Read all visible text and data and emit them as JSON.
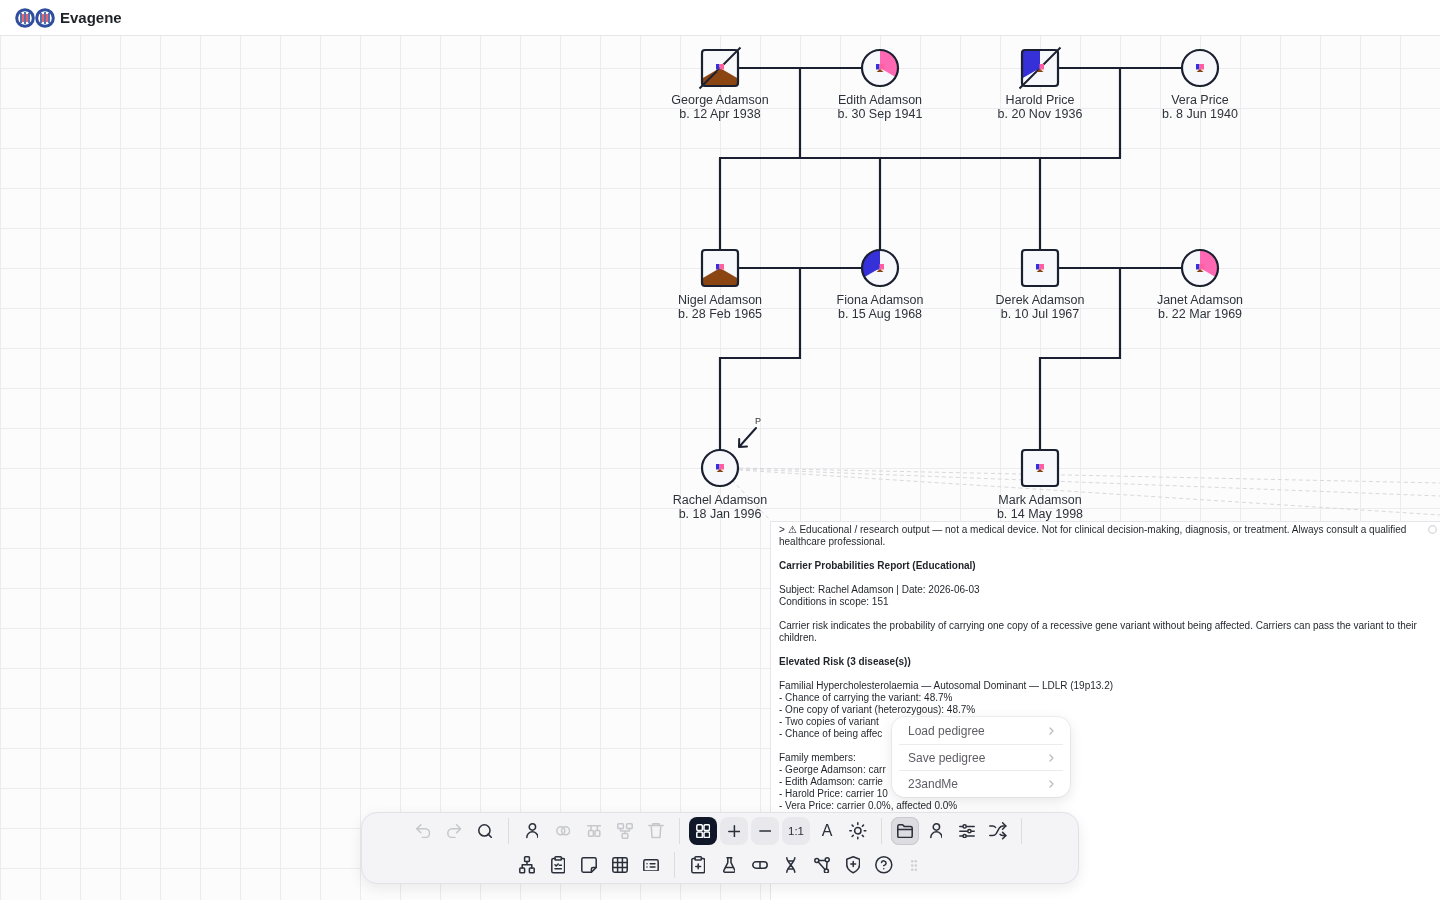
{
  "app": {
    "name": "Evagene"
  },
  "pedigree": {
    "proband_label": "P",
    "conditions": [
      {
        "color": "#ff69b4"
      },
      {
        "color": "#8b4513"
      },
      {
        "color": "#3530d8"
      }
    ],
    "generations": [
      {
        "individuals": [
          {
            "kind": "male",
            "name": "George Adamson",
            "birth": "b. 12 Apr 1938",
            "deceased": true,
            "proband": false,
            "affected": [
              false,
              true,
              false
            ]
          },
          {
            "kind": "female",
            "name": "Edith Adamson",
            "birth": "b. 30 Sep 1941",
            "deceased": false,
            "proband": false,
            "affected": [
              true,
              false,
              false
            ]
          },
          {
            "kind": "male",
            "name": "Harold Price",
            "birth": "b. 20 Nov 1936",
            "deceased": true,
            "proband": false,
            "affected": [
              false,
              false,
              true
            ]
          },
          {
            "kind": "female",
            "name": "Vera Price",
            "birth": "b. 8 Jun 1940",
            "deceased": false,
            "proband": false,
            "affected": [
              false,
              false,
              false
            ]
          }
        ]
      },
      {
        "individuals": [
          {
            "kind": "male",
            "name": "Nigel Adamson",
            "birth": "b. 28 Feb 1965",
            "deceased": false,
            "proband": false,
            "affected": [
              false,
              true,
              false
            ]
          },
          {
            "kind": "female",
            "name": "Fiona Adamson",
            "birth": "b. 15 Aug 1968",
            "deceased": false,
            "proband": false,
            "affected": [
              false,
              false,
              true
            ]
          },
          {
            "kind": "male",
            "name": "Derek Adamson",
            "birth": "b. 10 Jul 1967",
            "deceased": false,
            "proband": false,
            "affected": [
              false,
              false,
              false
            ]
          },
          {
            "kind": "female",
            "name": "Janet Adamson",
            "birth": "b. 22 Mar 1969",
            "deceased": false,
            "proband": false,
            "affected": [
              true,
              false,
              false
            ]
          }
        ]
      },
      {
        "individuals": [
          {
            "kind": "female",
            "name": "Rachel Adamson",
            "birth": "b. 18 Jan 1996",
            "deceased": false,
            "proband": true,
            "affected": [
              false,
              false,
              false
            ]
          },
          {
            "kind": "male",
            "name": "Mark Adamson",
            "birth": "b. 14 May 1998",
            "deceased": false,
            "proband": false,
            "affected": [
              false,
              false,
              false
            ]
          }
        ]
      }
    ]
  },
  "report": {
    "blocks": [
      {
        "kind": "paragraph",
        "text": "> ⚠ Educational / research output — not a medical device. Not for clinical decision-making, diagnosis, or treatment. Always consult a qualified healthcare professional."
      },
      {
        "kind": "heading",
        "text": "Carrier Probabilities Report (Educational)"
      },
      {
        "kind": "lines",
        "lines": [
          "Subject: Rachel Adamson | Date: 2026-06-03",
          "Conditions in scope: 151"
        ]
      },
      {
        "kind": "paragraph",
        "text": "Carrier risk indicates the probability of carrying one copy of a recessive gene variant without being affected. Carriers can pass the variant to their children."
      },
      {
        "kind": "heading",
        "text": "Elevated Risk (3 disease(s))"
      },
      {
        "kind": "lines",
        "lines": [
          "Familial Hypercholesterolaemia — Autosomal Dominant — LDLR (19p13.2)",
          "- Chance of carrying the variant: 48.7%",
          "- One copy of variant (heterozygous): 48.7%",
          "- Two copies of variant",
          "- Chance of being affec"
        ]
      },
      {
        "kind": "lines",
        "lines": [
          "Family members:",
          "- George Adamson: carr",
          "- Edith Adamson: carrie",
          "- Harold Price: carrier 10",
          "- Vera Price: carrier 0.0%, affected 0.0%"
        ]
      }
    ]
  },
  "menu": {
    "items": [
      {
        "label": "Load pedigree"
      },
      {
        "label": "Save pedigree"
      },
      {
        "label": "23andMe"
      }
    ]
  },
  "toolbar": {
    "rows": [
      {
        "groups": [
          {
            "divider": true,
            "items": [
              {
                "kind": "tool",
                "disabled": true,
                "selected": false,
                "expanded": false
              },
              {
                "kind": "tool",
                "disabled": true,
                "selected": false,
                "expanded": false
              },
              {
                "kind": "tool",
                "disabled": false,
                "selected": false,
                "expanded": false
              }
            ]
          },
          {
            "divider": true,
            "items": [
              {
                "kind": "tool",
                "disabled": false,
                "selected": false,
                "expanded": false
              },
              {
                "kind": "tool",
                "disabled": true,
                "selected": false,
                "expanded": false
              },
              {
                "kind": "tool",
                "disabled": true,
                "selected": false,
                "expanded": false
              },
              {
                "kind": "tool",
                "disabled": true,
                "selected": false,
                "expanded": false
              },
              {
                "kind": "tool",
                "disabled": true,
                "selected": false,
                "expanded": false
              }
            ]
          },
          {
            "divider": true,
            "items": [
              {
                "kind": "tool",
                "disabled": false,
                "selected": true,
                "expanded": false
              },
              {
                "kind": "zoom",
                "disabled": false,
                "selected": false,
                "expanded": false
              },
              {
                "kind": "zoom",
                "disabled": false,
                "selected": false,
                "expanded": false
              },
              {
                "kind": "zoom",
                "label": "1:1",
                "disabled": false,
                "selected": false,
                "expanded": false
              },
              {
                "kind": "tool",
                "label": "A",
                "disabled": false,
                "selected": false,
                "expanded": false
              },
              {
                "kind": "tool",
                "disabled": false,
                "selected": false,
                "expanded": false
              }
            ]
          },
          {
            "divider": true,
            "items": [
              {
                "kind": "tool",
                "disabled": false,
                "selected": false,
                "expanded": true
              },
              {
                "kind": "tool",
                "disabled": false,
                "selected": false,
                "expanded": false
              },
              {
                "kind": "tool",
                "disabled": false,
                "selected": false,
                "expanded": false
              },
              {
                "kind": "tool",
                "disabled": false,
                "selected": false,
                "expanded": false
              }
            ]
          }
        ]
      },
      {
        "groups": [
          {
            "divider": true,
            "items": [
              {
                "kind": "tool",
                "disabled": false,
                "selected": false,
                "expanded": false
              },
              {
                "kind": "tool",
                "disabled": false,
                "selected": false,
                "expanded": false
              },
              {
                "kind": "tool",
                "disabled": false,
                "selected": false,
                "expanded": false
              },
              {
                "kind": "tool",
                "disabled": false,
                "selected": false,
                "expanded": false
              },
              {
                "kind": "tool",
                "disabled": false,
                "selected": false,
                "expanded": false
              }
            ]
          },
          {
            "divider": false,
            "items": [
              {
                "kind": "tool",
                "disabled": false,
                "selected": false,
                "expanded": false
              },
              {
                "kind": "tool",
                "disabled": false,
                "selected": false,
                "expanded": false
              },
              {
                "kind": "tool",
                "disabled": false,
                "selected": false,
                "expanded": false
              },
              {
                "kind": "tool",
                "disabled": false,
                "selected": false,
                "expanded": false
              },
              {
                "kind": "tool",
                "disabled": false,
                "selected": false,
                "expanded": false
              },
              {
                "kind": "tool",
                "disabled": false,
                "selected": false,
                "expanded": false
              },
              {
                "kind": "tool",
                "disabled": false,
                "selected": false,
                "expanded": false
              },
              {
                "kind": "handle",
                "disabled": false,
                "selected": false,
                "expanded": false
              }
            ]
          }
        ]
      }
    ]
  }
}
